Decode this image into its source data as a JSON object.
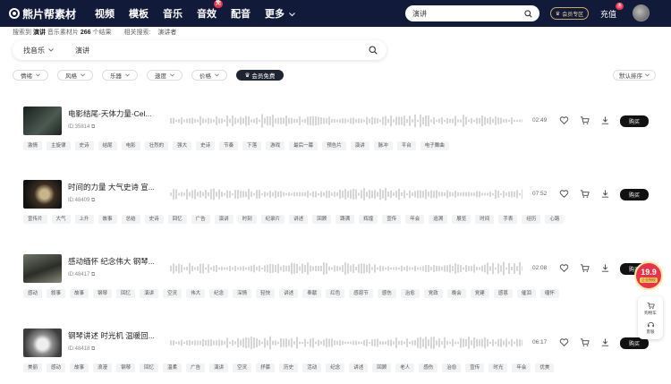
{
  "header": {
    "logo": "熊片帮素材",
    "nav": [
      {
        "label": "视频",
        "badge": ""
      },
      {
        "label": "模板",
        "badge": ""
      },
      {
        "label": "音乐",
        "badge": ""
      },
      {
        "label": "音效",
        "badge": "免"
      },
      {
        "label": "配音",
        "badge": ""
      },
      {
        "label": "更多",
        "badge": ""
      }
    ],
    "search_value": "演讲",
    "vip_zone": "会员专区",
    "recharge": "充值",
    "recharge_badge": "惠"
  },
  "result_line": {
    "prefix": "搜索到",
    "keyword": "演讲",
    "middle": "音乐素材片",
    "count": "266",
    "suffix": "个结果",
    "related_label": "相关搜索:",
    "related_word": "演讲者"
  },
  "search": {
    "category": "找音乐",
    "keyword": "演讲"
  },
  "filters": [
    "情绪",
    "风格",
    "乐器",
    "速度",
    "价格"
  ],
  "member_free": "会员免费",
  "sort": "默认排序",
  "tracks": [
    {
      "title": "电影结尾-天体力量-Cel...",
      "id": "ID:35814",
      "duration": "02:49",
      "buy": "购买",
      "tags": [
        "激情",
        "主旋律",
        "史诗",
        "结尾",
        "电影",
        "壮烈的",
        "强大",
        "史诗",
        "节奏",
        "下落",
        "游戏",
        "最后一幕",
        "预告片",
        "演讲",
        "脉冲",
        "平台",
        "电子舞曲"
      ]
    },
    {
      "title": "时间的力量 大气史诗 宣...",
      "id": "ID:48409",
      "duration": "07:52",
      "buy": "购买",
      "tags": [
        "宣传片",
        "大气",
        "上升",
        "故事",
        "总结",
        "史诗",
        "回忆",
        "广告",
        "演讲",
        "时刻",
        "纪录片",
        "讲述",
        "回顾",
        "踌满",
        "辉煌",
        "宣传",
        "年会",
        "追溯",
        "展览",
        "时间",
        "手表",
        "经历",
        "心路"
      ]
    },
    {
      "title": "感动缅怀 纪念伟大 钢琴...",
      "id": "ID:48417",
      "duration": "02:08",
      "buy": "购买",
      "tags": [
        "感动",
        "叙事",
        "故事",
        "钢琴",
        "回忆",
        "演讲",
        "空灵",
        "伟大",
        "纪念",
        "深情",
        "轻快",
        "讲述",
        "奉献",
        "红色",
        "感恩节",
        "感伤",
        "治愈",
        "党政",
        "晚会",
        "党建",
        "感恩",
        "催泪",
        "缅怀"
      ]
    },
    {
      "title": "钢琴讲述 时光机 温暖回...",
      "id": "ID:48418",
      "duration": "06:17",
      "buy": "购买",
      "tags": [
        "美丽",
        "感动",
        "故事",
        "浪漫",
        "钢琴",
        "回忆",
        "温柔",
        "广告",
        "演讲",
        "空灵",
        "抒慕",
        "历史",
        "活动",
        "纪念",
        "讲述",
        "回顾",
        "老人",
        "感伤",
        "治愈",
        "宣传",
        "时光",
        "年会",
        "优美"
      ]
    }
  ],
  "promo": {
    "price": "19.9",
    "label": "企业授权"
  },
  "sidepanel": {
    "cart": "购物车",
    "service": "客服"
  },
  "colors": {
    "topbar": "#121a3a",
    "accent": "#e9334b",
    "buy": "#111111",
    "tag_bg": "#f2f3f5"
  }
}
